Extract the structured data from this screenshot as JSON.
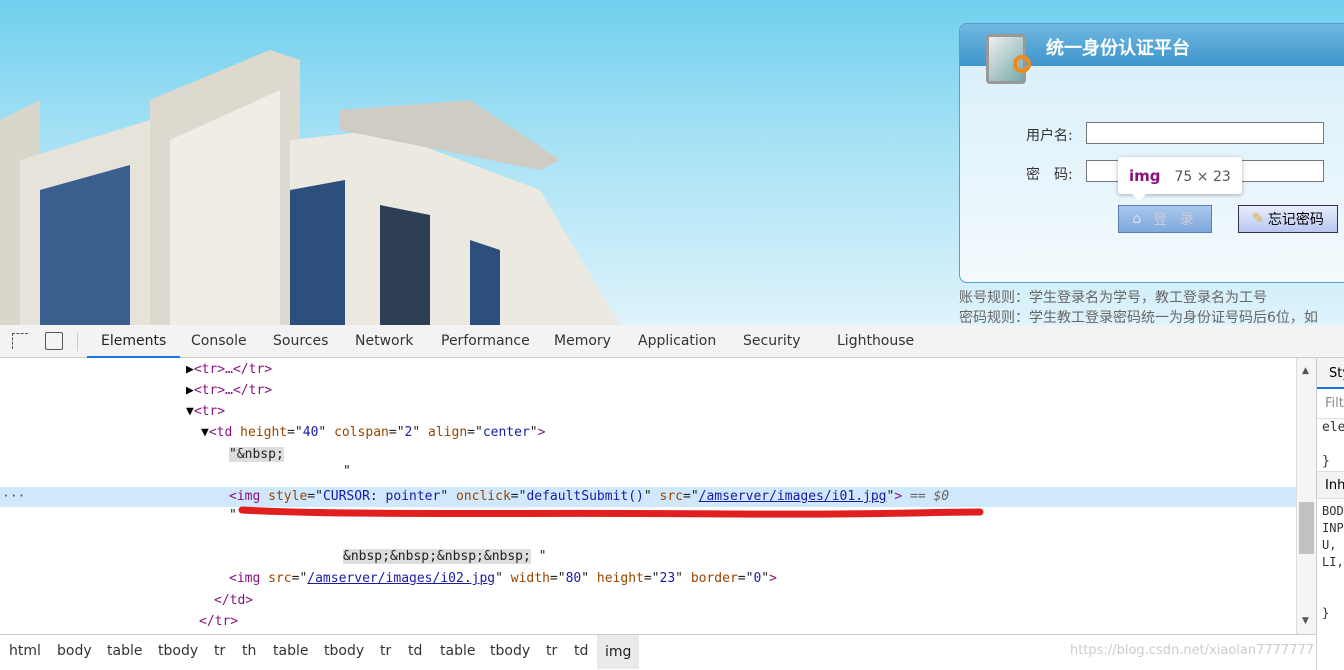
{
  "login": {
    "title": "统一身份认证平台",
    "username_label": "用户名:",
    "password_label": "密　码:",
    "username_value": "",
    "password_value": "",
    "login_button": "登 录",
    "forgot_button": "忘记密码",
    "rule_account": "账号规则：学生登录名为学号，教工登录名为工号",
    "rule_password": "密码规则：学生教工登录密码统一为身份证号码后6位，如"
  },
  "tooltip": {
    "tag": "img",
    "size": "75 × 23"
  },
  "devtools": {
    "tabs": [
      "Elements",
      "Console",
      "Sources",
      "Network",
      "Performance",
      "Memory",
      "Application",
      "Security",
      "Lighthouse"
    ],
    "active_tab": "Elements",
    "dom": {
      "r1": "<tr>…</tr>",
      "r2": "<tr>…</tr>",
      "r3": "<tr>",
      "td_attrs": [
        [
          "height",
          "40"
        ],
        [
          "colspan",
          "2"
        ],
        [
          "align",
          "center"
        ]
      ],
      "nbsp1": "\"&nbsp;",
      "quote": "\"",
      "img1": {
        "style": "CURSOR: pointer",
        "onclick": "defaultSubmit()",
        "src": "/amserver/images/i01.jpg",
        "marker": "== $0"
      },
      "nbsp4": "&nbsp;&nbsp;&nbsp;&nbsp;",
      "img2": {
        "src": "/amserver/images/i02.jpg",
        "width": "80",
        "height": "23",
        "border": "0"
      },
      "close_td": "</td>",
      "close_tr": "</tr>"
    },
    "styles": {
      "tab": "Styles",
      "filter": "Filter",
      "ele": "element.style {",
      "brace": "}",
      "inh": "Inherited",
      "lines": [
        "BODY,",
        "INPUT,",
        "U,",
        "LI,"
      ],
      "brace2": "}"
    },
    "breadcrumbs": [
      "html",
      "body",
      "table",
      "tbody",
      "tr",
      "th",
      "table",
      "tbody",
      "tr",
      "td",
      "table",
      "tbody",
      "tr",
      "td",
      "img"
    ],
    "active_crumb": "img"
  },
  "watermark": "https://blog.csdn.net/xiaolan7777777",
  "colors": {
    "accent": "#1a73e8",
    "selected_row": "#cfe8fc",
    "annotation": "#e02020"
  }
}
